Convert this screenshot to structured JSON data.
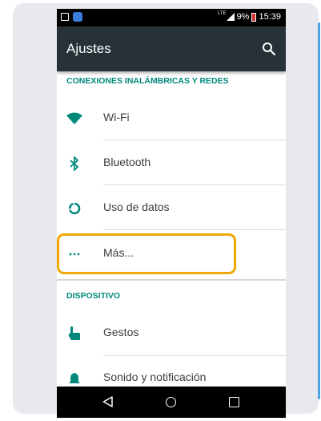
{
  "status_bar": {
    "lte": "LTE",
    "battery_percent": "9%",
    "time": "15:39"
  },
  "app_bar": {
    "title": "Ajustes",
    "search_icon": "search-icon"
  },
  "sections": [
    {
      "header": "CONEXIONES INALÁMBRICAS Y REDES",
      "items": [
        {
          "icon": "wifi-icon",
          "label": "Wi-Fi"
        },
        {
          "icon": "bluetooth-icon",
          "label": "Bluetooth"
        },
        {
          "icon": "data-usage-icon",
          "label": "Uso de datos"
        },
        {
          "icon": "more-icon",
          "label": "Más..."
        }
      ]
    },
    {
      "header": "DISPOSITIVO",
      "items": [
        {
          "icon": "gesture-icon",
          "label": "Gestos"
        },
        {
          "icon": "bell-icon",
          "label": "Sonido y notificación"
        }
      ]
    }
  ],
  "nav_bar": {
    "back_icon": "back-icon",
    "home_icon": "home-icon",
    "recent_icon": "recent-apps-icon"
  },
  "colors": {
    "accent": "#00897b",
    "app_bar": "#263238",
    "highlight": "#f0a800",
    "card_background": "#e8e9ee"
  }
}
